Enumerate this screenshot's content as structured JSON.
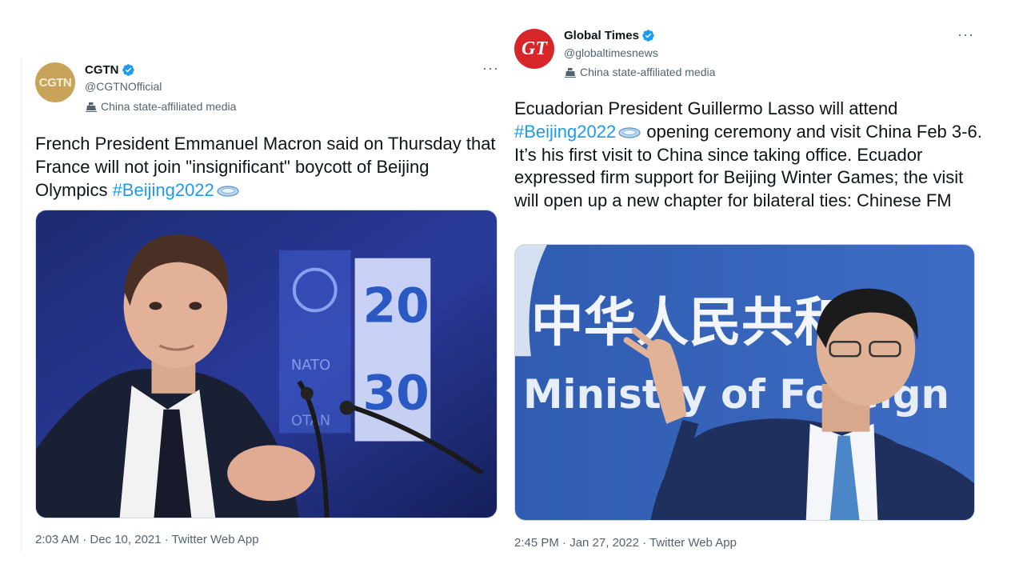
{
  "tweets": [
    {
      "display_name": "CGTN",
      "handle": "@CGTNOfficial",
      "avatar_text": "CGTN",
      "affiliation": "China state-affiliated media",
      "text_before": "French President Emmanuel Macron said on Thursday that France will not join \"insignificant\" boycott of Beijing Olympics ",
      "hashtag": "#Beijing2022",
      "text_after": "",
      "timestamp": "2:03 AM · Dec 10, 2021 · Twitter Web App",
      "image_text": {
        "sign_top": "20",
        "sign_bottom": "30",
        "sign_small": "NATO",
        "sign_small2": "OTAN"
      }
    },
    {
      "display_name": "Global Times",
      "handle": "@globaltimesnews",
      "avatar_text": "GT",
      "affiliation": "China state-affiliated media",
      "text_before": "Ecuadorian President Guillermo Lasso will attend ",
      "hashtag": "#Beijing2022",
      "text_after": " opening ceremony and visit China Feb 3-6. It’s his first visit to China since taking office. Ecuador expressed firm support for Beijing Winter Games; the visit will open up a new chapter for bilateral ties: Chinese FM",
      "timestamp": "2:45 PM · Jan 27, 2022 · Twitter Web App",
      "image_text": {
        "banner_cn": "中华人民共和国",
        "banner_en": "Ministry of Foreign"
      }
    }
  ],
  "colors": {
    "hashtag": "#1d9bf0",
    "verified": "#1d9bf0",
    "secondary_text": "#536471"
  },
  "icons": [
    "verified-badge-icon",
    "state-media-flag-icon",
    "more-options-icon",
    "beijing-2022-emoji-icon"
  ]
}
